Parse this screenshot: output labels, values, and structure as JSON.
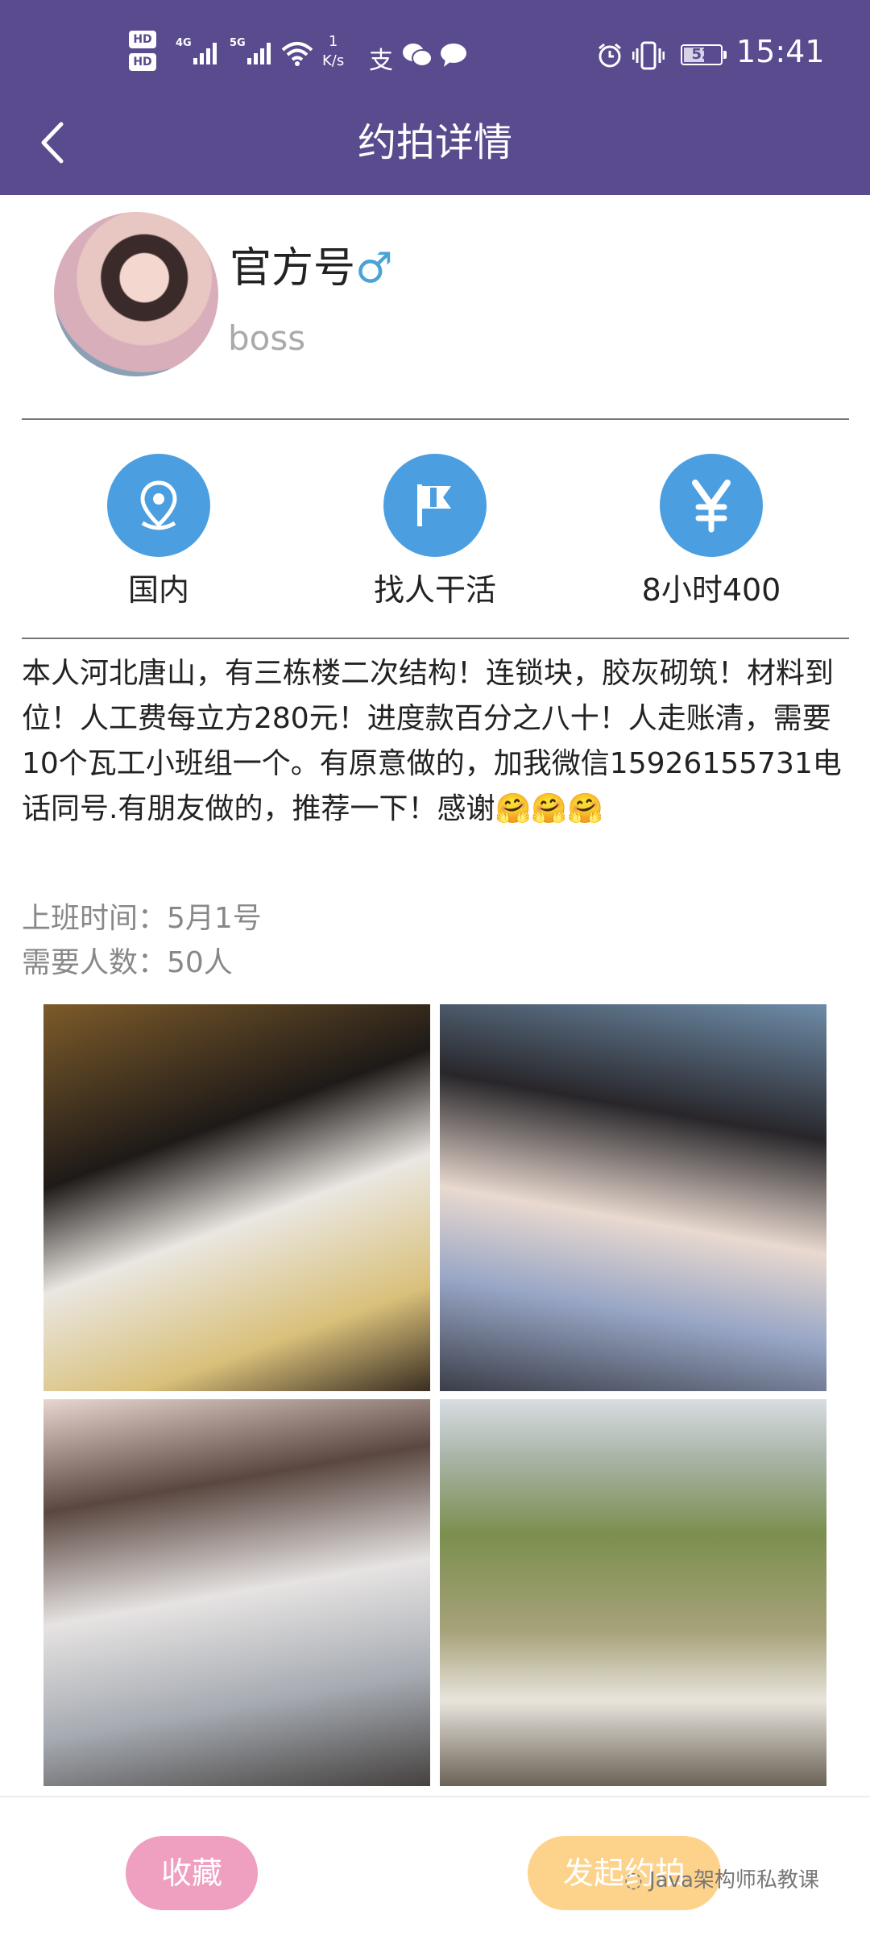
{
  "status_bar": {
    "hd1": "HD",
    "hd2": "HD",
    "net1": "4G",
    "net2": "5G",
    "speed_value": "1",
    "speed_unit": "K/s",
    "battery": "52",
    "time": "15:41"
  },
  "header": {
    "title": "约拍详情"
  },
  "profile": {
    "name": "官方号",
    "gender_symbol": "♂",
    "subtitle": "boss"
  },
  "features": [
    {
      "label": "国内",
      "icon": "location-pin-icon"
    },
    {
      "label": "找人干活",
      "icon": "flag-icon"
    },
    {
      "label": "8小时400",
      "icon": "yen-icon"
    }
  ],
  "description": "本人河北唐山，有三栋楼二次结构！连锁块，胶灰砌筑！材料到位！人工费每立方280元！进度款百分之八十！人走账清，需要10个瓦工小班组一个。有原意做的，加我微信15926155731电话同号.有朋友做的，推荐一下！感谢🤗🤗🤗",
  "details": {
    "work_time": "上班时间：5月1号",
    "headcount": "需要人数：50人"
  },
  "bottom_bar": {
    "favorite_label": "收藏",
    "start_label": "发起约拍",
    "watermark": "Java架构师私教课"
  },
  "colors": {
    "header": "#5a4a8e",
    "icon_circle": "#4b9fe1",
    "favorite": "#ef9fbf",
    "start": "#fdd38c",
    "gender": "#4aa3d8"
  }
}
